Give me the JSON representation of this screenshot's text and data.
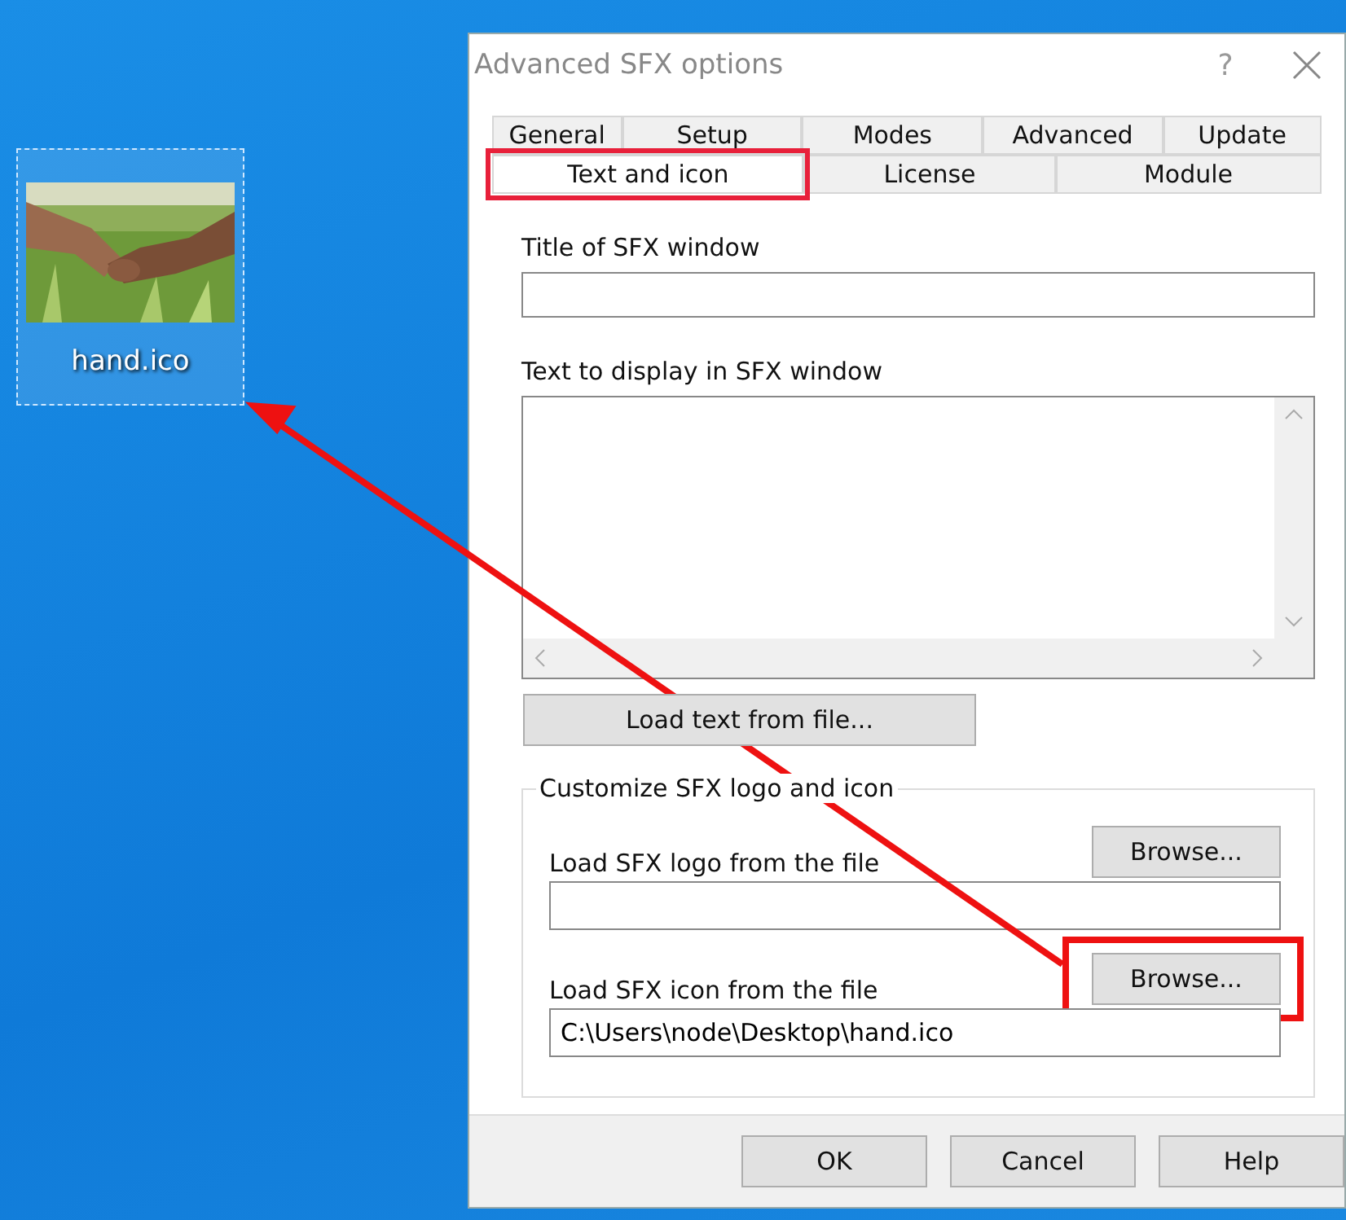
{
  "desktop_icon": {
    "label": "hand.ico",
    "selected": true
  },
  "window": {
    "title": "Advanced SFX options",
    "help": "?"
  },
  "tab_rows": [
    [
      {
        "label": "General",
        "selected": false
      },
      {
        "label": "Setup",
        "selected": false
      },
      {
        "label": "Modes",
        "selected": false
      },
      {
        "label": "Advanced",
        "selected": false
      },
      {
        "label": "Update",
        "selected": false
      }
    ],
    [
      {
        "label": "Text and icon",
        "selected": true,
        "highlighted": true
      },
      {
        "label": "License",
        "selected": false,
        "highlighted": false
      },
      {
        "label": "Module",
        "selected": false,
        "highlighted": false
      }
    ]
  ],
  "title_label": "Title of SFX window",
  "text_label": "Text to display in SFX window",
  "load_text_button": "Load text from file...",
  "group": {
    "title": "Customize SFX logo and icon",
    "rows": [
      {
        "label": "Load SFX logo from the file",
        "button": "Browse...",
        "highlighted": false
      },
      {
        "label": "Load SFX icon from the file",
        "button": "Browse...",
        "value": "C:\\Users\\node\\Desktop\\hand.ico",
        "highlighted": true
      }
    ]
  },
  "buttons": [
    "OK",
    "Cancel",
    "Help"
  ]
}
